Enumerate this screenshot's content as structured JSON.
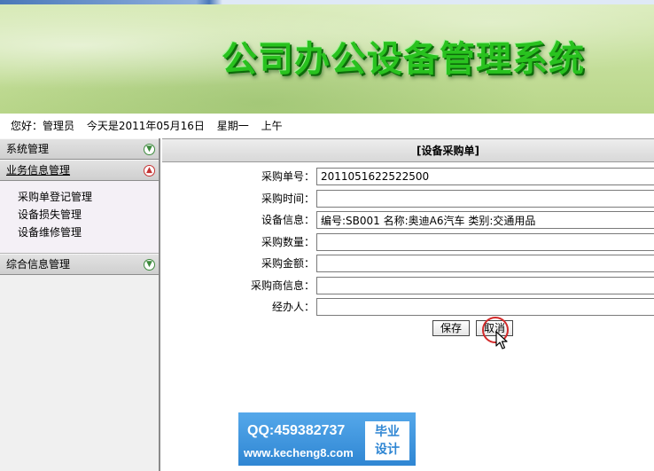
{
  "banner": {
    "title": "公司办公设备管理系统"
  },
  "greeting": {
    "hello": "您好：管理员",
    "date": "今天是2011年05月16日",
    "weekday": "星期一",
    "period": "上午"
  },
  "sidebar": {
    "sections": [
      {
        "label": "系统管理"
      },
      {
        "label": "业务信息管理"
      },
      {
        "label": "综合信息管理"
      }
    ],
    "items": [
      {
        "label": "采购单登记管理"
      },
      {
        "label": "设备损失管理"
      },
      {
        "label": "设备维修管理"
      }
    ]
  },
  "form": {
    "title": "[设备采购单]",
    "fields": [
      {
        "label": "采购单号：",
        "value": "2011051622522500"
      },
      {
        "label": "采购时间：",
        "value": ""
      },
      {
        "label": "设备信息：",
        "value": "编号:SB001 名称:奥迪A6汽车 类别:交通用品"
      },
      {
        "label": "采购数量：",
        "value": ""
      },
      {
        "label": "采购金额：",
        "value": ""
      },
      {
        "label": "采购商信息：",
        "value": ""
      },
      {
        "label": "经办人：",
        "value": ""
      }
    ],
    "save_label": "保存",
    "cancel_label": "取消"
  },
  "watermark": {
    "qq": "QQ:459382737",
    "url": "www.kecheng8.com",
    "badge_line1": "毕业",
    "badge_line2": "设计"
  },
  "colors": {
    "title_green": "#29c21f",
    "watermark_blue": "#2f86d3",
    "click_ring": "#d22a2a"
  }
}
